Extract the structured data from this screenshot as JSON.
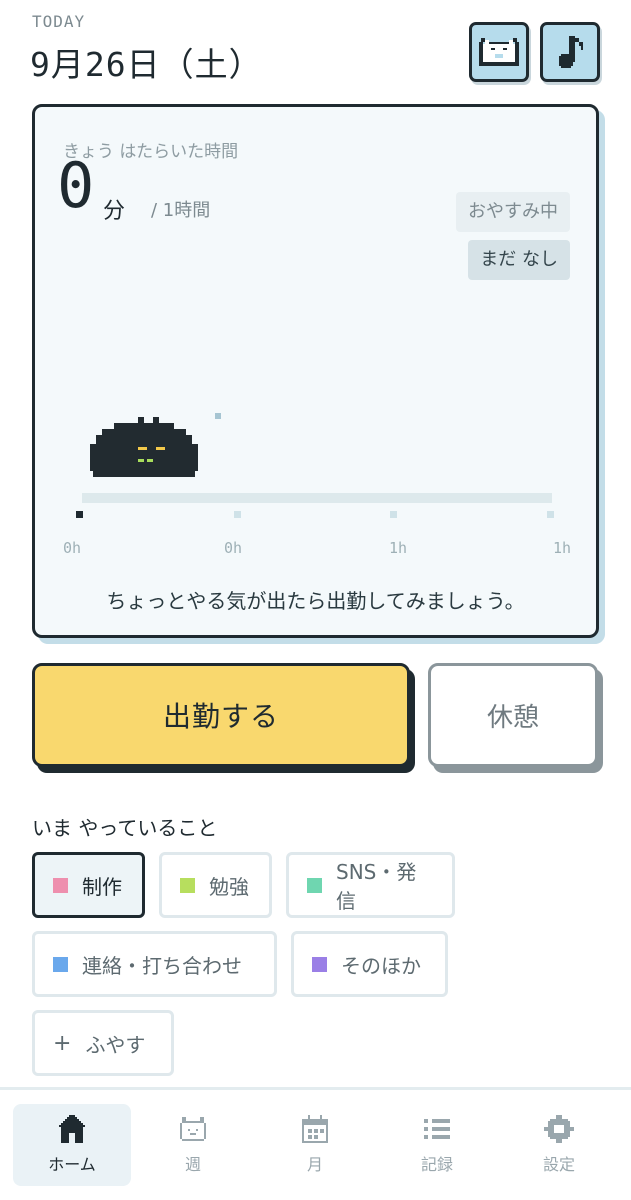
{
  "header": {
    "today_label": "TODAY",
    "date": "9月26日（土）",
    "cat_button_icon": "pixel-cat-icon",
    "music_button_icon": "music-note-icon"
  },
  "card": {
    "subtitle": "きょう はたらいた時間",
    "minutes": "0",
    "unit": "分",
    "goal": "/ 1時間",
    "status_badge": "おやすみ中",
    "entries_badge": "まだ なし",
    "timeline_labels": [
      "0h",
      "0h",
      "1h",
      "1h"
    ],
    "message": "ちょっとやる気が出たら出勤してみましょう。"
  },
  "actions": {
    "clock_in": "出勤する",
    "break": "休憩"
  },
  "activities": {
    "title": "いま やっていること",
    "items": [
      {
        "label": "制作",
        "color": "#ee8fae",
        "active": true
      },
      {
        "label": "勉強",
        "color": "#b7de5e",
        "active": false
      },
      {
        "label": "SNS・発信",
        "color": "#6fd6b0",
        "active": false
      },
      {
        "label": "連絡・打ち合わせ",
        "color": "#6aa8ec",
        "active": false
      },
      {
        "label": "そのほか",
        "color": "#9a7fe6",
        "active": false
      }
    ],
    "add_label": "ふやす",
    "add_icon": "plus-icon"
  },
  "nav": {
    "items": [
      {
        "label": "ホーム",
        "icon": "home-icon",
        "active": true
      },
      {
        "label": "週",
        "icon": "week-cat-icon",
        "active": false
      },
      {
        "label": "月",
        "icon": "calendar-icon",
        "active": false
      },
      {
        "label": "記録",
        "icon": "list-icon",
        "active": false
      },
      {
        "label": "設定",
        "icon": "gear-icon",
        "active": false
      }
    ]
  },
  "colors": {
    "accent_yellow": "#f9d86e",
    "ink": "#1f2a30",
    "card_bg": "#f4f9fb",
    "button_blue": "#b6dcec"
  }
}
